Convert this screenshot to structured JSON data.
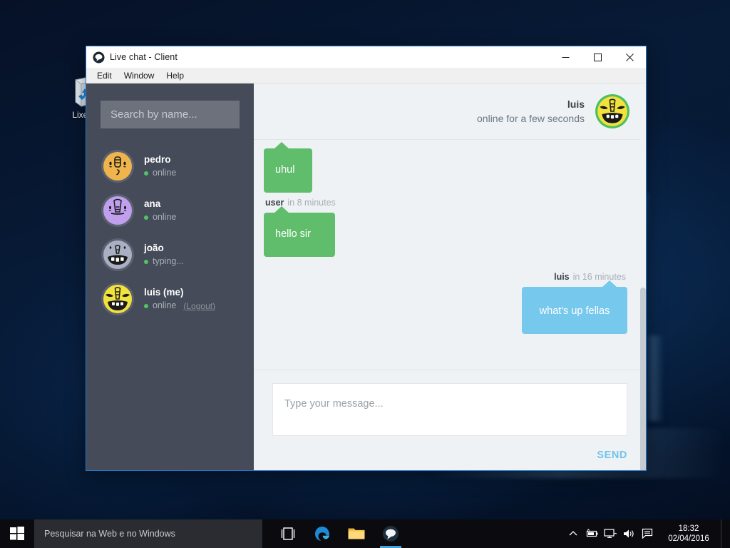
{
  "desktop": {
    "icons": [
      {
        "name": "recycle-bin",
        "label": "Lixeira",
        "icon": "recycle-bin-icon"
      }
    ]
  },
  "window": {
    "title": "Live chat - Client",
    "app_icon": "chat-bubble-icon",
    "controls": {
      "minimize": "minimize-icon",
      "maximize": "maximize-icon",
      "close": "close-icon"
    },
    "menu": [
      {
        "label": "Edit"
      },
      {
        "label": "Window"
      },
      {
        "label": "Help"
      }
    ]
  },
  "sidebar": {
    "search": {
      "placeholder": "Search by name...",
      "value": "",
      "icon": "search-icon"
    },
    "contacts": [
      {
        "name": "pedro",
        "status": "online",
        "status_color": "#51c46a",
        "avatar": {
          "bg": "#f0b council",
          "face": "monster-face-pedro"
        }
      },
      {
        "name": "ana",
        "status": "online",
        "status_color": "#51c46a",
        "avatar": {
          "bg": "#c0a0ee",
          "face": "monster-face-ana"
        }
      },
      {
        "name": "joão",
        "status": "typing...",
        "status_color": "#51c46a",
        "avatar": {
          "bg": "#aab0c4",
          "face": "monster-face-joao"
        }
      },
      {
        "name": "luis (me)",
        "status": "online",
        "status_color": "#51c46a",
        "logout_label": "(Logout)",
        "avatar": {
          "bg": "#f2e23d",
          "face": "monster-face-luis"
        }
      }
    ]
  },
  "chat": {
    "header": {
      "name": "luis",
      "status": "online for a few seconds",
      "avatar": {
        "bg": "#f2e23d",
        "ring": "#4cbf5e",
        "face": "monster-face-luis"
      }
    },
    "messages": [
      {
        "id": "m1",
        "side": "left",
        "color": "green",
        "text": "uhul",
        "bubble_hex": "#60bd6b"
      },
      {
        "id": "m2",
        "side": "left",
        "color": "green",
        "text": "hello sir",
        "bubble_hex": "#60bd6b",
        "meta": {
          "who": "user",
          "when": "in 8 minutes"
        }
      },
      {
        "id": "m3",
        "side": "right",
        "color": "blue",
        "text": "what's up fellas",
        "bubble_hex": "#77c8ed",
        "meta": {
          "who": "luis",
          "when": "in 16 minutes"
        }
      }
    ],
    "composer": {
      "placeholder": "Type your message...",
      "value": "",
      "send_label": "SEND",
      "send_color": "#74c4ea"
    }
  },
  "taskbar": {
    "start_icon": "windows-start-icon",
    "search_placeholder": "Pesquisar na Web e no Windows",
    "apps": [
      {
        "name": "task-view",
        "icon": "task-view-icon",
        "active": false
      },
      {
        "name": "edge",
        "icon": "edge-browser-icon",
        "active": false
      },
      {
        "name": "file-explorer",
        "icon": "file-explorer-icon",
        "active": false
      },
      {
        "name": "live-chat",
        "icon": "chat-bubble-icon",
        "active": true
      }
    ],
    "tray": [
      {
        "name": "show-hidden-icons",
        "icon": "chevron-up-icon"
      },
      {
        "name": "battery",
        "icon": "battery-icon"
      },
      {
        "name": "network",
        "icon": "network-monitor-icon"
      },
      {
        "name": "volume",
        "icon": "speaker-icon"
      },
      {
        "name": "action-center",
        "icon": "action-center-icon"
      }
    ],
    "clock": {
      "time": "18:32",
      "date": "02/04/2016"
    }
  }
}
